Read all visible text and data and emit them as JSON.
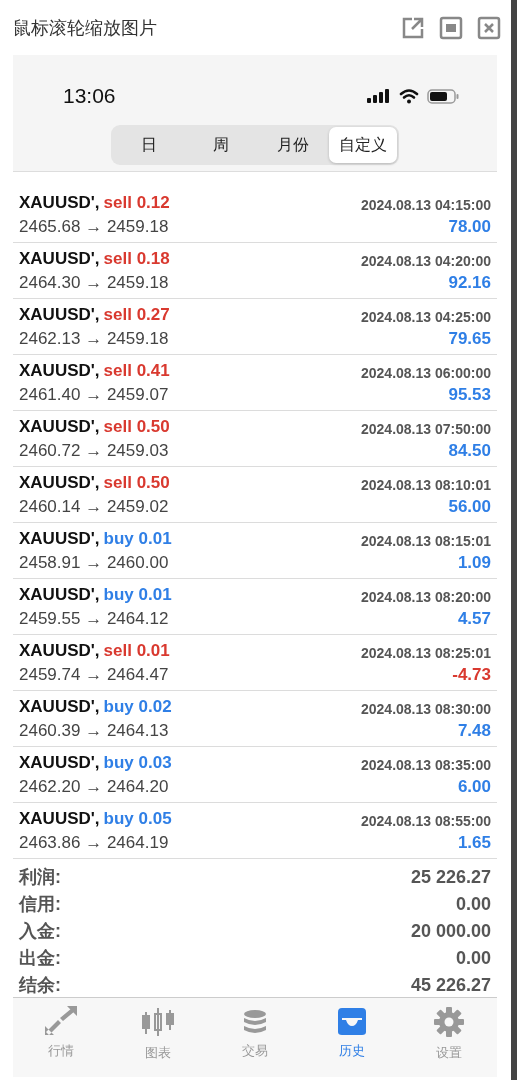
{
  "window": {
    "title": "鼠标滚轮缩放图片"
  },
  "status_bar": {
    "time": "13:06"
  },
  "period_tabs": [
    {
      "label": "日",
      "selected": false
    },
    {
      "label": "周",
      "selected": false
    },
    {
      "label": "月份",
      "selected": false
    },
    {
      "label": "自定义",
      "selected": true
    }
  ],
  "trades": [
    {
      "symbol": "XAUUSD',",
      "kind": "sell",
      "order": "sell 0.12",
      "time": "2024.08.13 04:15:00",
      "prices": "2465.68 → 2459.18",
      "profit": "78.00",
      "loss": false
    },
    {
      "symbol": "XAUUSD',",
      "kind": "sell",
      "order": "sell 0.18",
      "time": "2024.08.13 04:20:00",
      "prices": "2464.30 → 2459.18",
      "profit": "92.16",
      "loss": false
    },
    {
      "symbol": "XAUUSD',",
      "kind": "sell",
      "order": "sell 0.27",
      "time": "2024.08.13 04:25:00",
      "prices": "2462.13 → 2459.18",
      "profit": "79.65",
      "loss": false
    },
    {
      "symbol": "XAUUSD',",
      "kind": "sell",
      "order": "sell 0.41",
      "time": "2024.08.13 06:00:00",
      "prices": "2461.40 → 2459.07",
      "profit": "95.53",
      "loss": false
    },
    {
      "symbol": "XAUUSD',",
      "kind": "sell",
      "order": "sell 0.50",
      "time": "2024.08.13 07:50:00",
      "prices": "2460.72 → 2459.03",
      "profit": "84.50",
      "loss": false
    },
    {
      "symbol": "XAUUSD',",
      "kind": "sell",
      "order": "sell 0.50",
      "time": "2024.08.13 08:10:01",
      "prices": "2460.14 → 2459.02",
      "profit": "56.00",
      "loss": false
    },
    {
      "symbol": "XAUUSD',",
      "kind": "buy",
      "order": "buy 0.01",
      "time": "2024.08.13 08:15:01",
      "prices": "2458.91 → 2460.00",
      "profit": "1.09",
      "loss": false
    },
    {
      "symbol": "XAUUSD',",
      "kind": "buy",
      "order": "buy 0.01",
      "time": "2024.08.13 08:20:00",
      "prices": "2459.55 → 2464.12",
      "profit": "4.57",
      "loss": false
    },
    {
      "symbol": "XAUUSD',",
      "kind": "sell",
      "order": "sell 0.01",
      "time": "2024.08.13 08:25:01",
      "prices": "2459.74 → 2464.47",
      "profit": "-4.73",
      "loss": true
    },
    {
      "symbol": "XAUUSD',",
      "kind": "buy",
      "order": "buy 0.02",
      "time": "2024.08.13 08:30:00",
      "prices": "2460.39 → 2464.13",
      "profit": "7.48",
      "loss": false
    },
    {
      "symbol": "XAUUSD',",
      "kind": "buy",
      "order": "buy 0.03",
      "time": "2024.08.13 08:35:00",
      "prices": "2462.20 → 2464.20",
      "profit": "6.00",
      "loss": false
    },
    {
      "symbol": "XAUUSD',",
      "kind": "buy",
      "order": "buy 0.05",
      "time": "2024.08.13 08:55:00",
      "prices": "2463.86 → 2464.19",
      "profit": "1.65",
      "loss": false
    }
  ],
  "summary": [
    {
      "label": "利润:",
      "value": "25 226.27"
    },
    {
      "label": "信用:",
      "value": "0.00"
    },
    {
      "label": "入金:",
      "value": "20 000.00"
    },
    {
      "label": "出金:",
      "value": "0.00"
    },
    {
      "label": "结余:",
      "value": "45 226.27"
    }
  ],
  "nav": [
    {
      "kind": "quotes",
      "label": "行情",
      "selected": false
    },
    {
      "kind": "chart",
      "label": "图表",
      "selected": false
    },
    {
      "kind": "trade",
      "label": "交易",
      "selected": false
    },
    {
      "kind": "history",
      "label": "历史",
      "selected": true
    },
    {
      "kind": "settings",
      "label": "设置",
      "selected": false
    }
  ]
}
